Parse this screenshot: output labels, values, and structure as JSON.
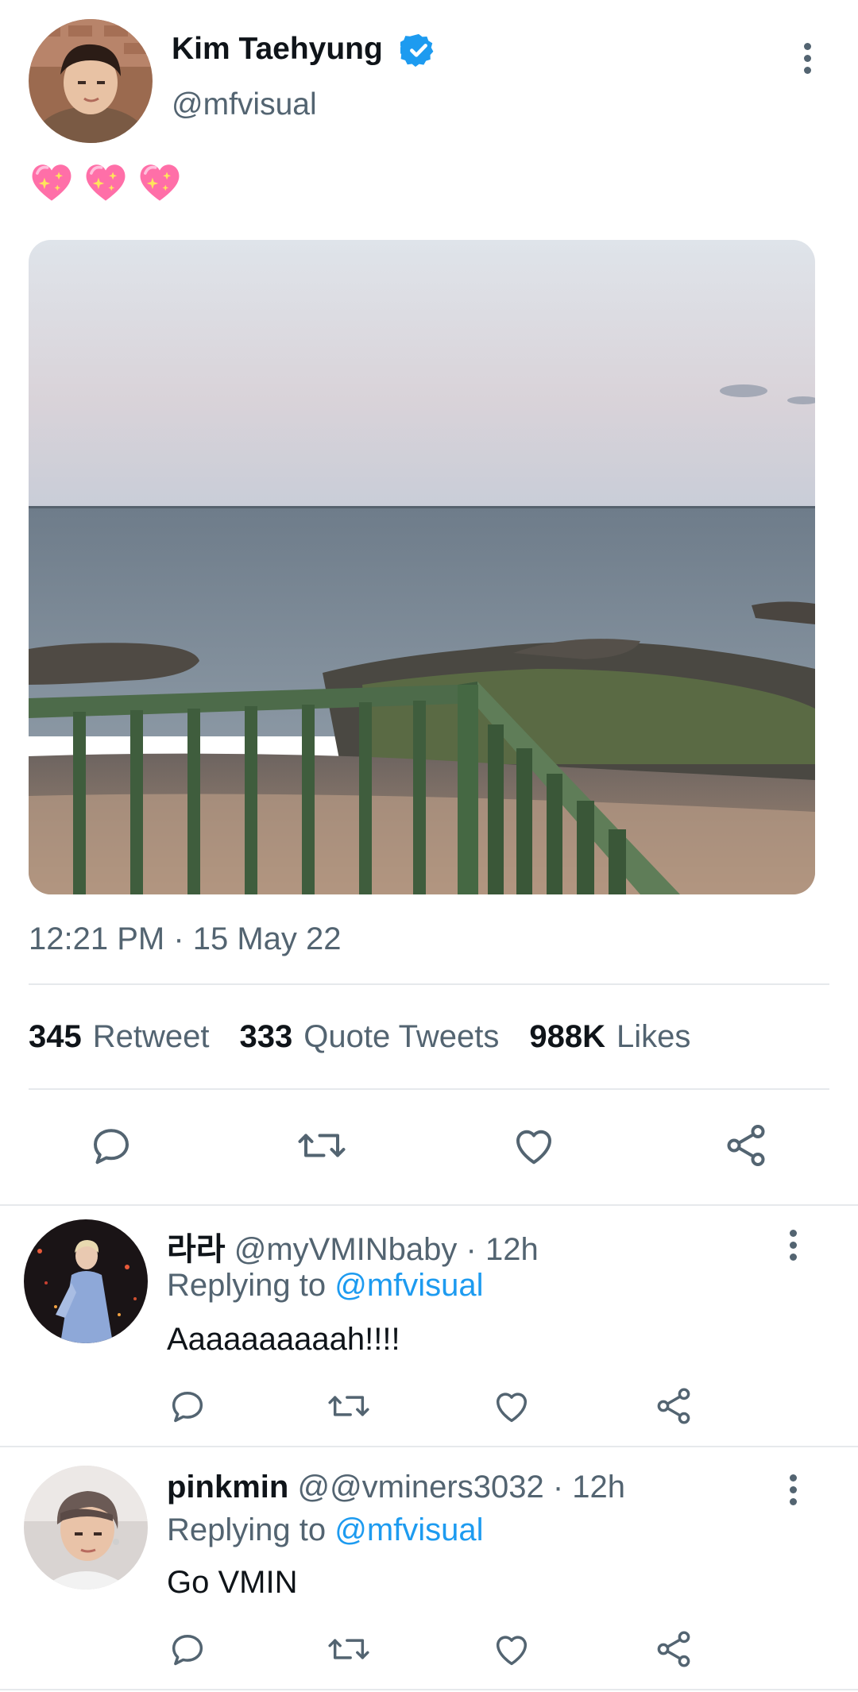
{
  "tweet": {
    "author_name": "Kim Taehyung",
    "author_handle": "@mfvisual",
    "emoji_text": "💖💖💖",
    "timestamp": "12:21 PM · 15 May 22",
    "stats": [
      {
        "count": "345",
        "label": "Retweet"
      },
      {
        "count": "333",
        "label": "Quote Tweets"
      },
      {
        "count": "988K",
        "label": "Likes"
      }
    ],
    "actions": [
      "reply-icon",
      "retweet-icon",
      "like-icon",
      "share-icon"
    ]
  },
  "replies": [
    {
      "name": "라라",
      "handle": "@myVMINbaby",
      "time": "12h",
      "replying_label": "Replying to",
      "replying_handle": "@mfvisual",
      "text": "Aaaaaaaaaah!!!!"
    },
    {
      "name": "pinkmin",
      "handle": "@@vminers3032",
      "time": "12h",
      "replying_label": "Replying to",
      "replying_handle": "@mfvisual",
      "text": "Go VMIN"
    }
  ],
  "colors": {
    "link": "#1d9bf0",
    "muted": "#536471",
    "verified": "#1d9bf0",
    "heart_pink": "#ff6fa8"
  }
}
